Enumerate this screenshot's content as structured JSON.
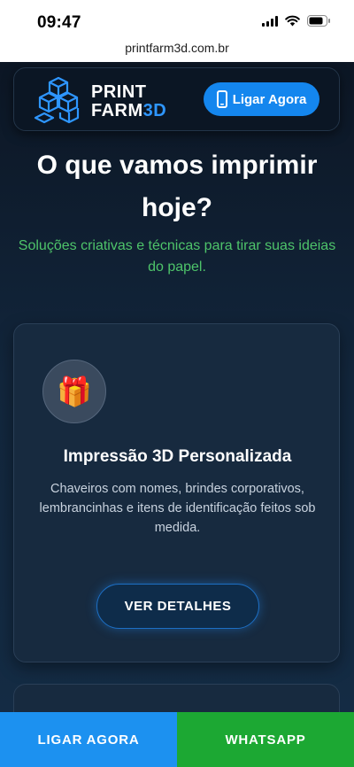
{
  "status_bar": {
    "time": "09:47",
    "icons": [
      "signal-icon",
      "wifi-icon",
      "battery-icon"
    ]
  },
  "browser": {
    "url": "printfarm3d.com.br"
  },
  "header": {
    "brand_line1": "PRINT",
    "brand_line2": "FARM",
    "brand_accent": "3D",
    "call_label": "Ligar Agora",
    "logo_icon": "cubes-logo-icon",
    "phone_icon": "phone-icon"
  },
  "hero": {
    "title": "O que vamos imprimir hoje?",
    "subtitle": "Soluções criativas e técnicas para tirar suas ideias do papel."
  },
  "service_card": {
    "icon": "🎁",
    "icon_name": "gift-icon",
    "title": "Impressão 3D Personalizada",
    "description": "Chaveiros com nomes, brindes corporativos, lembrancinhas e itens de identificação feitos sob medida.",
    "button_label": "VER DETALHES"
  },
  "bottom_bar": {
    "call_label": "LIGAR AGORA",
    "whatsapp_label": "WHATSAPP"
  },
  "colors": {
    "accent_blue": "#1486ee",
    "brand_3d": "#2e96ff",
    "subtitle_green": "#4ec46a",
    "whatsapp_green": "#1ca833"
  }
}
